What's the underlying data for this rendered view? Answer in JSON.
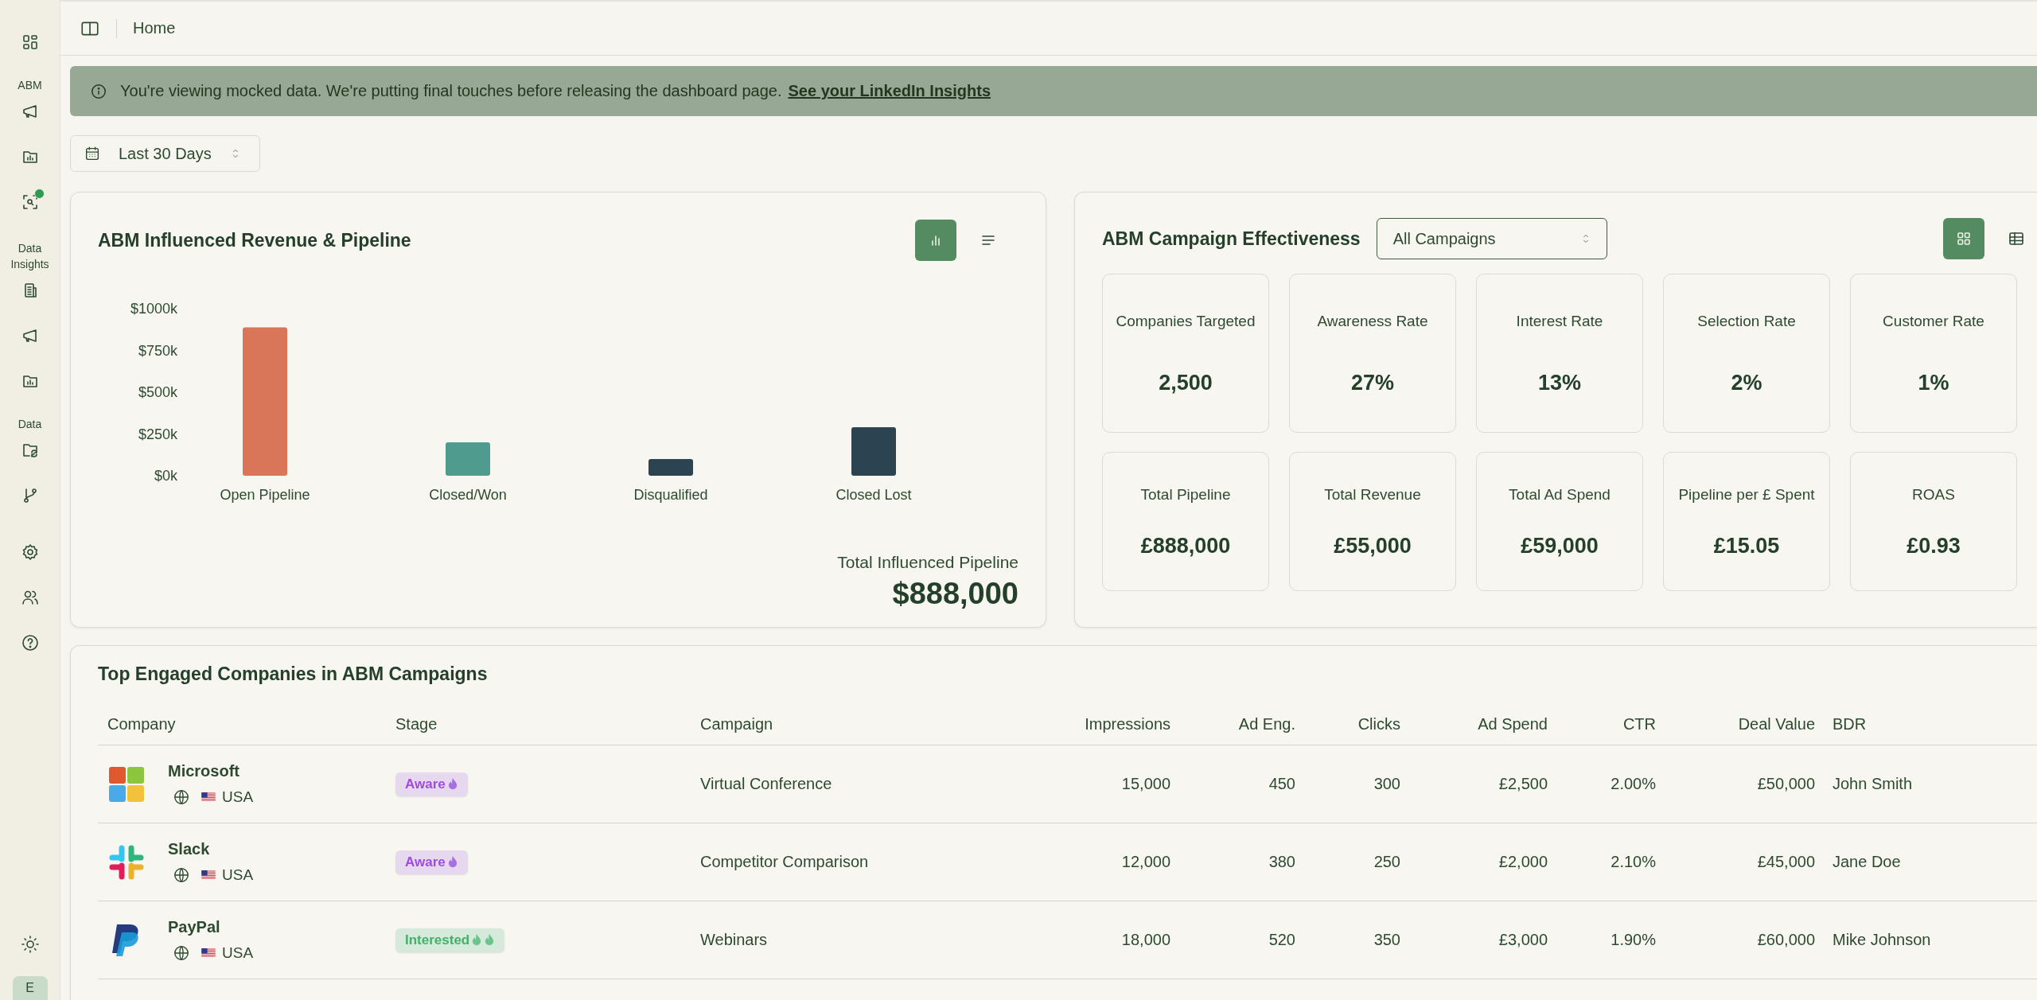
{
  "sidebar": {
    "sections": [
      {
        "label": "ABM"
      },
      {
        "label": "Data Insights"
      },
      {
        "label": "Data"
      }
    ],
    "notification": true,
    "avatar": "E"
  },
  "header": {
    "breadcrumb": "Home"
  },
  "banner": {
    "text": "You're viewing mocked data. We're putting final touches before releasing the dashboard page.",
    "link": "See your LinkedIn Insights"
  },
  "date_range": {
    "value": "Last 30 Days"
  },
  "revenue_card": {
    "title": "ABM Influenced Revenue & Pipeline",
    "view_toggle": [
      {
        "selected": true
      },
      {
        "selected": false
      }
    ],
    "chart_data": {
      "type": "bar",
      "categories": [
        "Open Pipeline",
        "Closed/Won",
        "Disqualified",
        "Closed Lost"
      ],
      "values": [
        888,
        200,
        100,
        290
      ],
      "colors": [
        "#d97559",
        "#4f9c8f",
        "#2c4451",
        "#2c4451"
      ],
      "ylim": [
        0,
        1000
      ],
      "yticks": [
        {
          "value": 0,
          "label": "$0k"
        },
        {
          "value": 250,
          "label": "$250k"
        },
        {
          "value": 500,
          "label": "$500k"
        },
        {
          "value": 750,
          "label": "$750k"
        },
        {
          "value": 1000,
          "label": "$1000k"
        }
      ]
    },
    "total_label": "Total Influenced Pipeline",
    "total_value": "$888,000"
  },
  "effectiveness_card": {
    "title": "ABM Campaign Effectiveness",
    "campaign_select": "All Campaigns",
    "view_toggle": [
      {
        "selected": true
      },
      {
        "selected": false
      }
    ],
    "metrics": [
      {
        "label": "Companies Targeted",
        "value": "2,500"
      },
      {
        "label": "Awareness Rate",
        "value": "27%"
      },
      {
        "label": "Interest Rate",
        "value": "13%"
      },
      {
        "label": "Selection Rate",
        "value": "2%"
      },
      {
        "label": "Customer Rate",
        "value": "1%"
      },
      {
        "label": "Total Pipeline",
        "value": "£888,000"
      },
      {
        "label": "Total Revenue",
        "value": "£55,000"
      },
      {
        "label": "Total Ad Spend",
        "value": "£59,000"
      },
      {
        "label": "Pipeline per £ Spent",
        "value": "£15.05"
      },
      {
        "label": "ROAS",
        "value": "£0.93"
      }
    ]
  },
  "table": {
    "title": "Top Engaged Companies in ABM Campaigns",
    "columns": [
      "Company",
      "Stage",
      "Campaign",
      "Impressions",
      "Ad Eng.",
      "Clicks",
      "Ad Spend",
      "CTR",
      "Deal Value",
      "BDR"
    ],
    "rows": [
      {
        "kind": "squares",
        "company": "Microsoft",
        "country": "USA",
        "stage": {
          "label": "Aware",
          "kind": "aware"
        },
        "campaign": "Virtual Conference",
        "impressions": "15,000",
        "ad_eng": "450",
        "clicks": "300",
        "ad_spend": "£2,500",
        "ctr": "2.00%",
        "deal_value": "£50,000",
        "bdr": "John Smith"
      },
      {
        "kind": "pinwheel",
        "company": "Slack",
        "country": "USA",
        "stage": {
          "label": "Aware",
          "kind": "aware"
        },
        "campaign": "Competitor Comparison",
        "impressions": "12,000",
        "ad_eng": "380",
        "clicks": "250",
        "ad_spend": "£2,000",
        "ctr": "2.10%",
        "deal_value": "£45,000",
        "bdr": "Jane Doe"
      },
      {
        "kind": "pmark",
        "company": "PayPal",
        "country": "USA",
        "stage": {
          "label": "Interested",
          "kind": "interested"
        },
        "campaign": "Webinars",
        "impressions": "18,000",
        "ad_eng": "520",
        "clicks": "350",
        "ad_spend": "£3,000",
        "ctr": "1.90%",
        "deal_value": "£60,000",
        "bdr": "Mike Johnson"
      }
    ]
  }
}
